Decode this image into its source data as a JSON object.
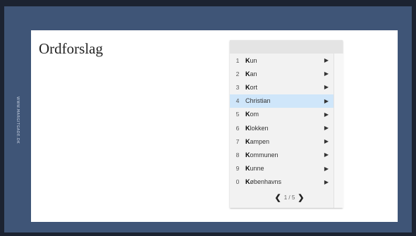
{
  "sidebar_text": "WWW.MARGITGADE.DK",
  "slide": {
    "title": "Ordforslag"
  },
  "suggestions": [
    {
      "num": "1",
      "prefix": "K",
      "rest": "un"
    },
    {
      "num": "2",
      "prefix": "K",
      "rest": "an"
    },
    {
      "num": "3",
      "prefix": "K",
      "rest": "ort"
    },
    {
      "num": "4",
      "prefix": "",
      "rest": "Christian",
      "selected": true
    },
    {
      "num": "5",
      "prefix": "K",
      "rest": "om"
    },
    {
      "num": "6",
      "prefix": "K",
      "rest": "lokken"
    },
    {
      "num": "7",
      "prefix": "K",
      "rest": "ampen"
    },
    {
      "num": "8",
      "prefix": "K",
      "rest": "ommunen"
    },
    {
      "num": "9",
      "prefix": "K",
      "rest": "unne"
    },
    {
      "num": "0",
      "prefix": "K",
      "rest": "øbenhavns"
    }
  ],
  "arrow_glyph": "▶",
  "pager": {
    "prev": "❮",
    "text": "1 / 5",
    "next": "❯"
  }
}
